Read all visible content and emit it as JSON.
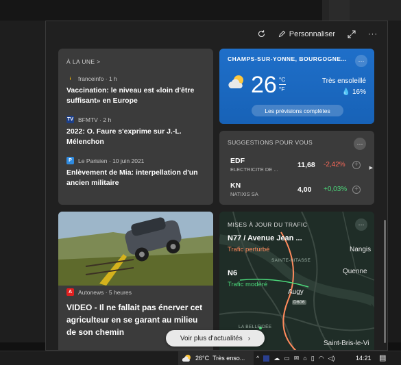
{
  "toolbar": {
    "personalize_label": "Personnaliser",
    "refresh_icon": "refresh-icon",
    "expand_icon": "expand-icon",
    "more_icon": "more-icon"
  },
  "top_stories": {
    "header": "À LA UNE >",
    "stories": [
      {
        "source": "franceinfo · 1 h",
        "logo": "franceinfo-logo",
        "logo_color": "#ffc000",
        "headline": "Vaccination: le niveau est «loin d'être suffisant» en Europe"
      },
      {
        "source": "BFMTV · 2 h",
        "logo": "bfmtv-logo",
        "logo_color": "#ffffff",
        "headline": "2022: O. Faure s'exprime sur J.-L. Mélenchon"
      },
      {
        "source": "Le Parisien · 10 juin 2021",
        "logo": "leparisien-logo",
        "logo_color": "#2f8be0",
        "headline": "Enlèvement de Mia: interpellation d'un ancien militaire"
      }
    ]
  },
  "weather": {
    "location": "CHAMPS-SUR-YONNE, BOURGOGNE...",
    "temperature": "26",
    "unit_c": "°C",
    "unit_f": "°F",
    "condition": "Très ensoleillé",
    "precipitation": "💧 16%",
    "forecast_button": "Les prévisions complètes",
    "icon": "partly-sunny-icon"
  },
  "suggestions": {
    "header": "SUGGESTIONS POUR VOUS",
    "stocks": [
      {
        "symbol": "EDF",
        "name": "ELECTRICITE DE ...",
        "price": "11,68",
        "change": "-2,42%",
        "change_color": "#ff6a5a"
      },
      {
        "symbol": "KN",
        "name": "NATIXIS SA",
        "price": "4,00",
        "change": "+0,03%",
        "change_color": "#4cd97b"
      }
    ]
  },
  "news_card": {
    "source": "Autonews · 5 heures",
    "logo_color": "#e02020",
    "title": "VIDEO - Il ne fallait pas énerver cet agriculteur en se garant au milieu de son chemin"
  },
  "traffic": {
    "header": "MISES À JOUR DU TRAFIC",
    "routes": [
      {
        "road": "N77 / Avenue Jean ...",
        "status": "Trafic perturbé",
        "status_color": "#ff8a5c"
      },
      {
        "road": "N6",
        "status": "Trafic modéré",
        "status_color": "#4cd97b"
      }
    ],
    "map_labels": {
      "nangis": "Nangis",
      "quenne": "Quenne",
      "augy": "Augy",
      "saint_bris": "Saint-Bris-le-Vi",
      "sainte_nitasse": "SAINTE-NITASSE",
      "la_belle_idee": "LA BELLEIDÉE",
      "d606": "D606"
    }
  },
  "more_news_button": "Voir plus d'actualités",
  "taskbar": {
    "weather_temp": "26°C",
    "weather_text": "Très enso...",
    "time": "14:21"
  }
}
